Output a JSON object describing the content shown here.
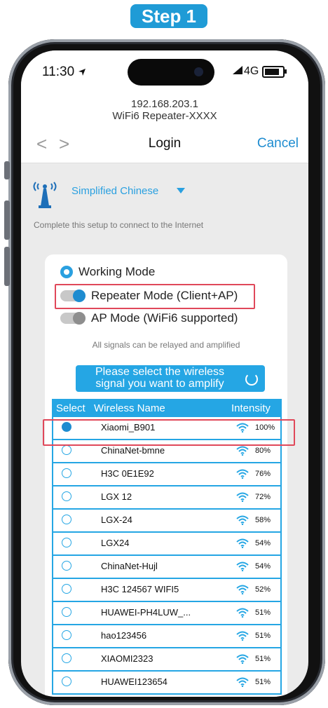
{
  "step_label": "Step 1",
  "status_bar": {
    "time": "11:30",
    "network": "4G"
  },
  "browser": {
    "url_ip": "192.168.203.1",
    "page_subtitle": "WiFi6 Repeater-XXXX",
    "back_arrow": "<",
    "forward_arrow": ">",
    "title": "Login",
    "cancel_label": "Cancel"
  },
  "language": {
    "selected": "Simplified Chinese"
  },
  "setup_instruction": "Complete this setup to connect to the Internet",
  "working_mode": {
    "title": "Working Mode",
    "repeater_label": "Repeater Mode (Client+AP)",
    "ap_label": "AP Mode (WiFi6 supported)",
    "relay_note": "All signals can be relayed and amplified"
  },
  "select_banner": {
    "line1": "Please select the wireless",
    "line2": "signal you want to amplify"
  },
  "network_table": {
    "headers": {
      "select": "Select",
      "name": "Wireless Name",
      "intensity": "Intensity"
    },
    "rows": [
      {
        "name": "Xiaomi_B901",
        "intensity": "100%",
        "selected": true
      },
      {
        "name": "ChinaNet-bmne",
        "intensity": "80%",
        "selected": false
      },
      {
        "name": "H3C 0E1E92",
        "intensity": "76%",
        "selected": false
      },
      {
        "name": "LGX 12",
        "intensity": "72%",
        "selected": false
      },
      {
        "name": "LGX-24",
        "intensity": "58%",
        "selected": false
      },
      {
        "name": "LGX24",
        "intensity": "54%",
        "selected": false
      },
      {
        "name": "ChinaNet-Hujl",
        "intensity": "54%",
        "selected": false
      },
      {
        "name": "H3C 124567 WIFI5",
        "intensity": "52%",
        "selected": false
      },
      {
        "name": "HUAWEI-PH4LUW_...",
        "intensity": "51%",
        "selected": false
      },
      {
        "name": "hao123456",
        "intensity": "51%",
        "selected": false
      },
      {
        "name": "XIAOMI2323",
        "intensity": "51%",
        "selected": false
      },
      {
        "name": "HUAWEI123654",
        "intensity": "51%",
        "selected": false
      }
    ]
  },
  "colors": {
    "accent": "#25a6e4",
    "link": "#1e8cd0",
    "highlight": "#e0485a"
  },
  "icons": [
    "antenna-icon",
    "gear-icon",
    "refresh-icon",
    "wifi-icon",
    "location-arrow-icon"
  ]
}
